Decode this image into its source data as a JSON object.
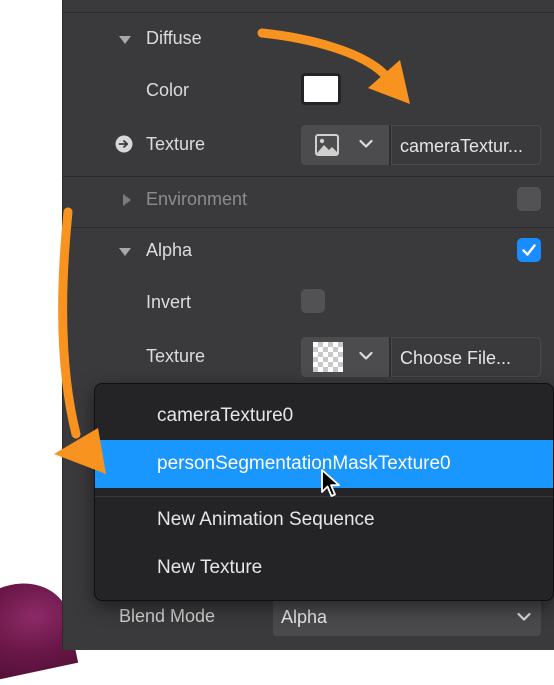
{
  "panel": {
    "diffuse": {
      "header": "Diffuse",
      "color_label": "Color",
      "color_value": "#ffffff",
      "texture_label": "Texture",
      "texture_value": "cameraTextur..."
    },
    "environment": {
      "header": "Environment",
      "checked": false
    },
    "alpha": {
      "header": "Alpha",
      "checked": true,
      "invert_label": "Invert",
      "invert_checked": false,
      "texture_label": "Texture",
      "texture_value": "Choose File..."
    },
    "blend": {
      "label": "Blend Mode",
      "value": "Alpha"
    }
  },
  "dropdown": {
    "items": [
      {
        "label": "cameraTexture0"
      },
      {
        "label": "personSegmentationMaskTexture0"
      },
      {
        "label": "New Animation Sequence"
      },
      {
        "label": "New Texture"
      }
    ],
    "selected_index": 1
  },
  "colors": {
    "panel_bg": "#3a3a3c",
    "selection": "#1a96ff",
    "checkbox_checked": "#1a8cff",
    "annotation_arrow": "#f7931e"
  },
  "icons": [
    "triangle-down-icon",
    "triangle-right-icon",
    "arrow-right-circle-icon",
    "image-icon",
    "chevron-down-icon",
    "checkmark-icon",
    "cursor-pointer-icon"
  ]
}
